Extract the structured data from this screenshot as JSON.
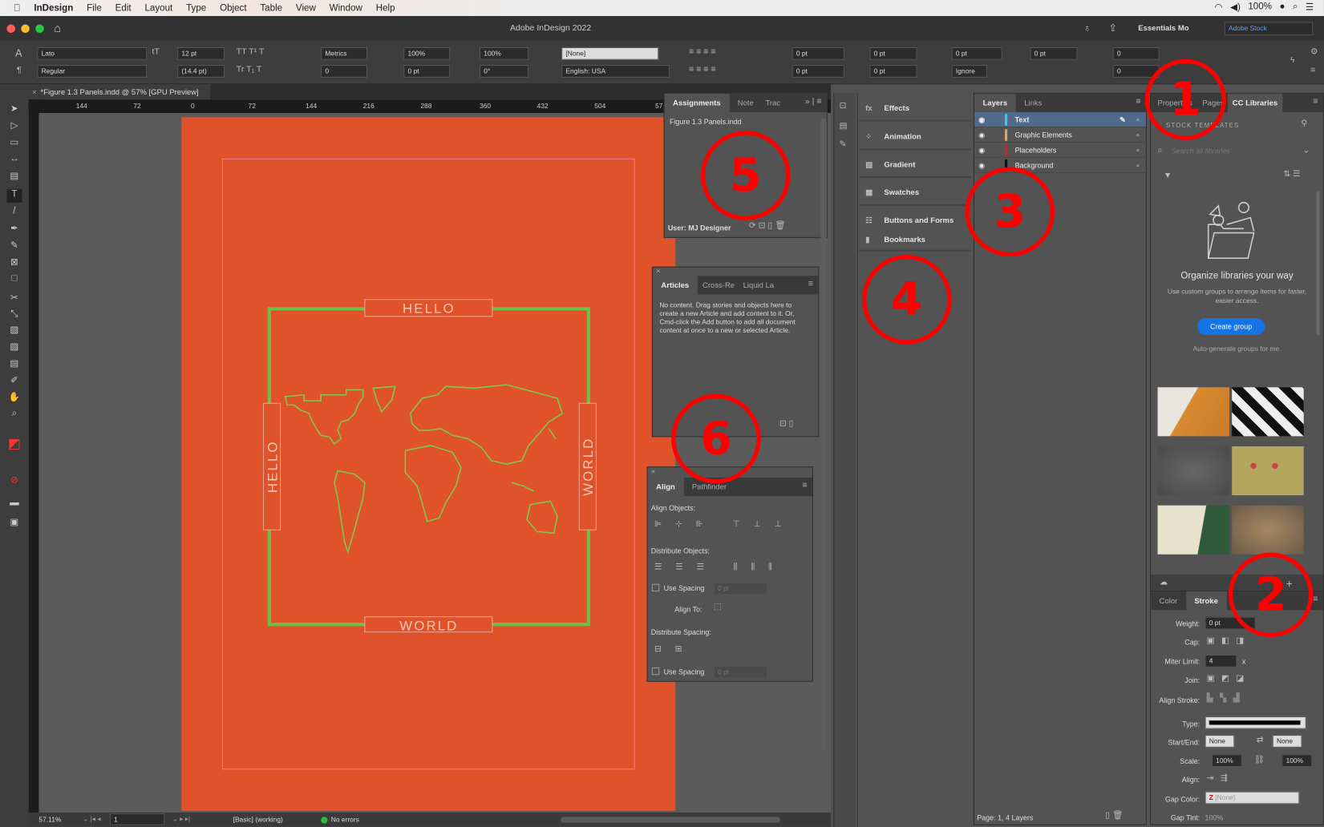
{
  "menubar": {
    "app": "InDesign",
    "items": [
      "File",
      "Edit",
      "Layout",
      "Type",
      "Object",
      "Table",
      "View",
      "Window",
      "Help"
    ],
    "battery": "100%"
  },
  "window": {
    "title": "Adobe InDesign 2022",
    "workspace": "Essentials Mo",
    "stock_placeholder": "Adobe Stock"
  },
  "control": {
    "font": "Lato",
    "style": "Regular",
    "size": "12 pt",
    "leading": "(14.4 pt)",
    "kerning": "Metrics",
    "tracking": "0",
    "vscale": "100%",
    "hscale": "100%",
    "baseline": "0 pt",
    "skew": "0°",
    "char_style": "[None]",
    "language": "English: USA",
    "left_indent": "0 pt",
    "first_indent": "0 pt",
    "right_indent": "0 pt",
    "last_indent": "0 pt",
    "space_before": "0 pt",
    "space_after": "0 pt",
    "drop_lines": "0",
    "drop_chars": "0",
    "grid": "Ignore"
  },
  "doc_tab": "*Figure 1.3 Panels.indd @ 57% [GPU Preview]",
  "ruler": [
    "144",
    "72",
    "0",
    "72",
    "144",
    "216",
    "288",
    "360",
    "432",
    "504",
    "57"
  ],
  "artwork": {
    "top": "HELLO",
    "bottom": "WORLD",
    "left": "HELLO",
    "right": "WORLD",
    "frame_color": "#6cc04a",
    "page_color": "#e0532a"
  },
  "assignments": {
    "tabs": [
      "Assignments",
      "Note",
      "Trac"
    ],
    "file": "Figure 1.3 Panels.indd",
    "user": "User: MJ Designer"
  },
  "articles": {
    "tabs": [
      "Articles",
      "Cross-Re",
      "Liquid La"
    ],
    "message": "No content. Drag stories and objects here to create a new Article and add content to it. Or, Cmd-click the Add button to add all document content at once to a new or selected Article."
  },
  "align": {
    "tabs": [
      "Align",
      "Pathfinder"
    ],
    "align_objects": "Align Objects:",
    "distribute_objects": "Distribute Objects:",
    "use_spacing": "Use Spacing",
    "spacing_value": "0 pt",
    "align_to": "Align To:",
    "distribute_spacing": "Distribute Spacing:",
    "use_spacing2": "Use Spacing",
    "spacing_value2": "0 pt"
  },
  "stacked": [
    "Effects",
    "Animation",
    "Gradient",
    "Swatches",
    "Buttons and Forms",
    "Bookmarks"
  ],
  "layers": {
    "tabs": [
      "Layers",
      "Links"
    ],
    "items": [
      {
        "name": "Text",
        "color": "#3cc8d8"
      },
      {
        "name": "Graphic Elements",
        "color": "#e8a060"
      },
      {
        "name": "Placeholders",
        "color": "#d02020"
      },
      {
        "name": "Background",
        "color": "#111111"
      }
    ],
    "footer": "Page: 1, 4 Layers"
  },
  "cclib": {
    "tabs": [
      "Properties",
      "Pages",
      "CC Libraries"
    ],
    "stock": "STOCK TEMPLATES",
    "search_placeholder": "Search all libraries",
    "heading": "Organize libraries your way",
    "sub": "Use custom groups to arrange items for faster, easier access.",
    "button": "Create group",
    "auto": "Auto-generate groups for me."
  },
  "stroke": {
    "tabs": [
      "Color",
      "Stroke"
    ],
    "weight_label": "Weight:",
    "weight": "0 pt",
    "cap": "Cap:",
    "miter_label": "Miter Limit:",
    "miter": "4",
    "miter_unit": "x",
    "join": "Join:",
    "align_stroke": "Align Stroke:",
    "type": "Type:",
    "start_end": "Start/End:",
    "start": "None",
    "end": "None",
    "scale_label": "Scale:",
    "scale1": "100%",
    "scale2": "100%",
    "align": "Align:",
    "gap_color_label": "Gap Color:",
    "gap_color": "[None]",
    "gap_tint_label": "Gap Tint:",
    "gap_tint": "100%"
  },
  "status": {
    "zoom": "57.11%",
    "page": "1",
    "preflight_profile": "[Basic] (working)",
    "errors": "No errors"
  },
  "callouts": [
    "1",
    "2",
    "3",
    "4",
    "5",
    "6"
  ]
}
